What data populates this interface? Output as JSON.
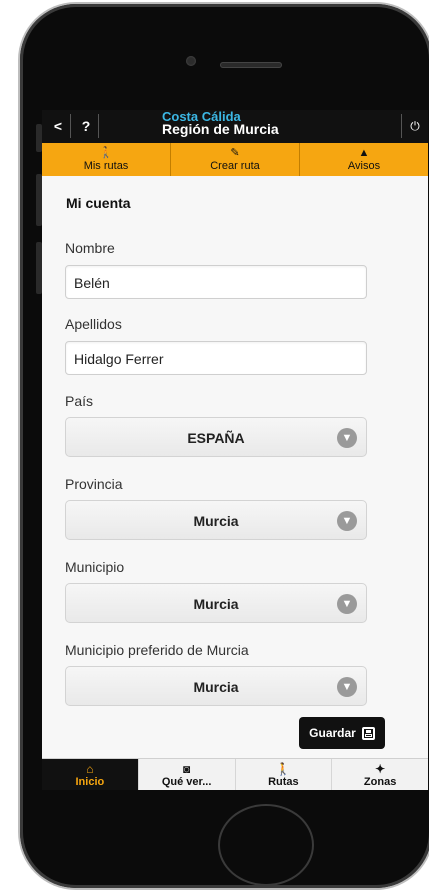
{
  "topbar": {
    "back_label": "<",
    "help_label": "?",
    "brand_line1": "Costa Cálida",
    "brand_line2": "Región de Murcia",
    "power_icon": "power-icon"
  },
  "tabs": [
    {
      "label": "Mis rutas",
      "icon": "hiker-icon"
    },
    {
      "label": "Crear ruta",
      "icon": "pin-icon"
    },
    {
      "label": "Avisos",
      "icon": "warning-icon"
    }
  ],
  "form": {
    "title": "Mi cuenta",
    "nombre_label": "Nombre",
    "nombre_value": "Belén",
    "apellidos_label": "Apellidos",
    "apellidos_value": "Hidalgo Ferrer",
    "pais_label": "País",
    "pais_value": "ESPAÑA",
    "provincia_label": "Provincia",
    "provincia_value": "Murcia",
    "municipio_label": "Municipio",
    "municipio_value": "Murcia",
    "municipio_pref_label": "Municipio preferido de Murcia",
    "municipio_pref_value": "Murcia",
    "save_label": "Guardar"
  },
  "bottom_nav": [
    {
      "label": "Inicio",
      "icon": "home-icon",
      "active": true
    },
    {
      "label": "Qué ver...",
      "icon": "camera-icon",
      "active": false
    },
    {
      "label": "Rutas",
      "icon": "hiker-icon",
      "active": false
    },
    {
      "label": "Zonas",
      "icon": "location-icon",
      "active": false
    }
  ],
  "colors": {
    "accent": "#f6a611",
    "brand_blue": "#3cb7e4",
    "bar_dark": "#111111"
  }
}
